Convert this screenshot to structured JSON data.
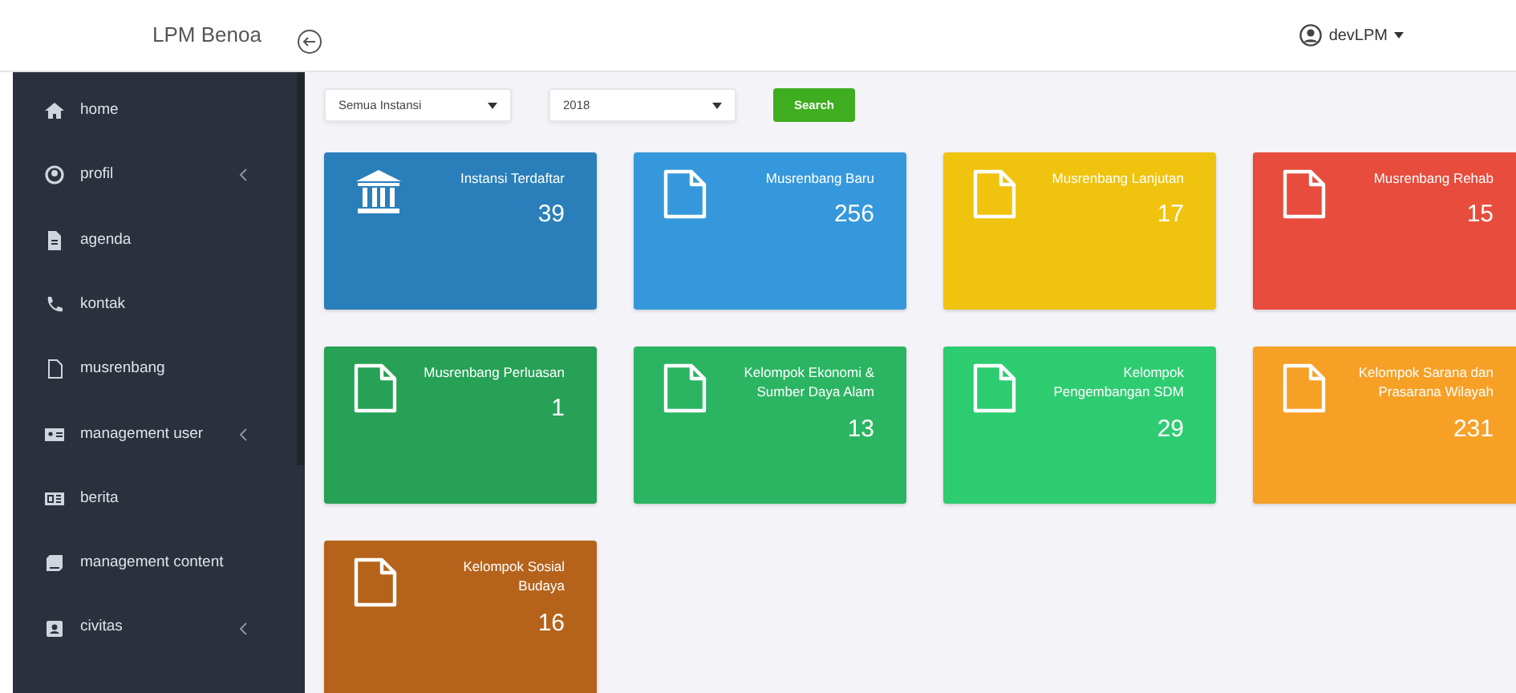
{
  "brand": "LPM Benoa",
  "user": {
    "name": "devLPM"
  },
  "sidebar": {
    "items": [
      {
        "label": "home",
        "expandable": false
      },
      {
        "label": "profil",
        "expandable": true
      },
      {
        "label": "agenda",
        "expandable": false
      },
      {
        "label": "kontak",
        "expandable": false
      },
      {
        "label": "musrenbang",
        "expandable": false
      },
      {
        "label": "management user",
        "expandable": true
      },
      {
        "label": "berita",
        "expandable": false
      },
      {
        "label": "management content",
        "expandable": false
      },
      {
        "label": "civitas",
        "expandable": true
      }
    ]
  },
  "filters": {
    "instansi": "Semua Instansi",
    "year": "2018",
    "button": "Search"
  },
  "cards": [
    {
      "kind": "institution",
      "title": "Instansi Terdaftar",
      "count": "39",
      "color": "#2a7fba"
    },
    {
      "kind": "document",
      "title": "Musrenbang Baru",
      "count": "256",
      "color": "#3598dc"
    },
    {
      "kind": "document",
      "title": "Musrenbang Lanjutan",
      "count": "17",
      "color": "#f0c30f"
    },
    {
      "kind": "document",
      "title": "Musrenbang Rehab",
      "count": "15",
      "color": "#e74c3c"
    },
    {
      "kind": "document",
      "title": "Musrenbang Perluasan",
      "count": "1",
      "color": "#26a155"
    },
    {
      "kind": "document",
      "title": "Kelompok Ekonomi & Sumber Daya Alam",
      "count": "13",
      "color": "#2bb562"
    },
    {
      "kind": "document",
      "title": "Kelompok Pengembangan SDM",
      "count": "29",
      "color": "#2ecc71"
    },
    {
      "kind": "document",
      "title": "Kelompok Sarana dan Prasarana Wilayah",
      "count": "231",
      "color": "#f7a026"
    },
    {
      "kind": "document",
      "title": "Kelompok Sosial Budaya",
      "count": "16",
      "color": "#b5631b"
    }
  ]
}
